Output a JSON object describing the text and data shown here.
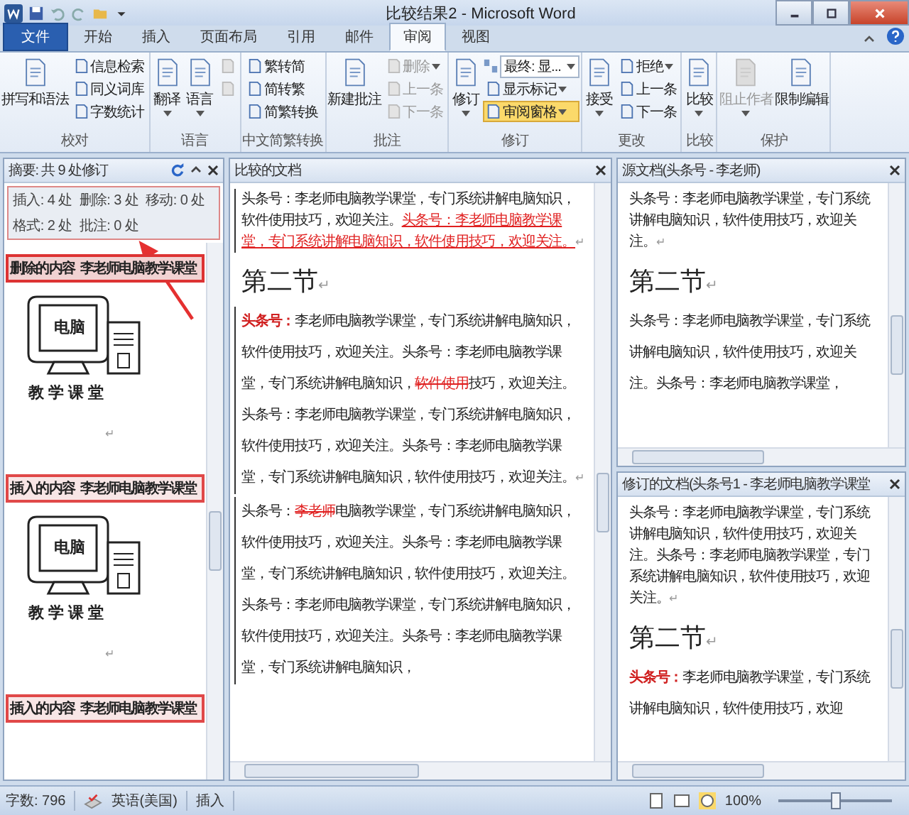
{
  "title_bar": {
    "title": "比较结果2 - Microsoft Word"
  },
  "tabs": [
    {
      "label": "文件",
      "kind": "file",
      "selected": false
    },
    {
      "label": "开始",
      "kind": "tab",
      "selected": false
    },
    {
      "label": "插入",
      "kind": "tab",
      "selected": false
    },
    {
      "label": "页面布局",
      "kind": "tab",
      "selected": false
    },
    {
      "label": "引用",
      "kind": "tab",
      "selected": false
    },
    {
      "label": "邮件",
      "kind": "tab",
      "selected": false
    },
    {
      "label": "审阅",
      "kind": "tab",
      "selected": true
    },
    {
      "label": "视图",
      "kind": "tab",
      "selected": false
    }
  ],
  "ribbon_groups": [
    {
      "label": "校对",
      "buttons": [
        {
          "label": "拼写和语法",
          "kind": "large",
          "disabled": false,
          "dropdown": false
        },
        {
          "label": "信息检索",
          "kind": "small",
          "disabled": false,
          "dropdown": false
        },
        {
          "label": "同义词库",
          "kind": "small",
          "disabled": false,
          "dropdown": false
        },
        {
          "label": "字数统计",
          "kind": "small",
          "disabled": false,
          "dropdown": false
        }
      ]
    },
    {
      "label": "语言",
      "buttons": [
        {
          "label": "翻译",
          "kind": "large",
          "disabled": false,
          "dropdown": true
        },
        {
          "label": "语言",
          "kind": "large",
          "disabled": false,
          "dropdown": true
        },
        {
          "kind": "small",
          "disabled": true,
          "dropdown": false
        },
        {
          "kind": "small",
          "disabled": true,
          "dropdown": false
        }
      ]
    },
    {
      "label": "中文简繁转换",
      "buttons": [
        {
          "label": "繁转简",
          "kind": "small",
          "disabled": false,
          "dropdown": false
        },
        {
          "label": "简转繁",
          "kind": "small",
          "disabled": false,
          "dropdown": false
        },
        {
          "label": "简繁转换",
          "kind": "small",
          "disabled": false,
          "dropdown": false
        }
      ]
    },
    {
      "label": "批注",
      "buttons": [
        {
          "label": "新建批注",
          "kind": "large",
          "disabled": false,
          "dropdown": false
        },
        {
          "label": "删除",
          "kind": "small",
          "disabled": true,
          "dropdown": true
        },
        {
          "label": "上一条",
          "kind": "small",
          "disabled": true,
          "dropdown": false
        },
        {
          "label": "下一条",
          "kind": "small",
          "disabled": true,
          "dropdown": false
        }
      ]
    },
    {
      "label": "修订",
      "buttons": [
        {
          "label": "修订",
          "kind": "large",
          "disabled": false,
          "dropdown": true
        },
        {
          "label": "最终: 显...",
          "kind": "combo",
          "disabled": false,
          "dropdown": true
        },
        {
          "label": "显示标记",
          "kind": "small",
          "disabled": false,
          "dropdown": true
        },
        {
          "label": "审阅窗格",
          "kind": "small",
          "disabled": false,
          "dropdown": true,
          "on": true
        }
      ]
    },
    {
      "label": "更改",
      "buttons": [
        {
          "label": "接受",
          "kind": "large",
          "disabled": false,
          "dropdown": true
        },
        {
          "label": "拒绝",
          "kind": "small",
          "disabled": false,
          "dropdown": true
        },
        {
          "label": "上一条",
          "kind": "small",
          "disabled": false,
          "dropdown": false
        },
        {
          "label": "下一条",
          "kind": "small",
          "disabled": false,
          "dropdown": false
        }
      ]
    },
    {
      "label": "比较",
      "buttons": [
        {
          "label": "比较",
          "kind": "large",
          "disabled": false,
          "dropdown": true
        }
      ]
    },
    {
      "label": "保护",
      "buttons": [
        {
          "label": "阻止作者",
          "kind": "large",
          "disabled": true,
          "dropdown": true
        },
        {
          "label": "限制编辑",
          "kind": "large",
          "disabled": false,
          "dropdown": false
        }
      ]
    }
  ],
  "review_pane": {
    "title": "摘要: 共 9 处修订",
    "summary": [
      "插入: 4 处  删除: 3 处  移动: 0 处",
      "格式: 2 处  批注: 0 处"
    ],
    "entries": [
      {
        "kind": "deleted",
        "label": "删除的内容",
        "author": "李老师电脑教学课堂",
        "image": {
          "screen_text": "电脑",
          "caption": "教 学 课 堂"
        },
        "mark": "↵"
      },
      {
        "kind": "inserted",
        "label": "插入的内容",
        "author": "李老师电脑教学课堂",
        "image": {
          "screen_text": "电脑",
          "caption": "教 学 课 堂"
        },
        "mark": "↵"
      },
      {
        "kind": "inserted",
        "label": "插入的内容",
        "author": "李老师电脑教学课堂"
      }
    ]
  },
  "compared_document": {
    "title": "比较的文档",
    "blocks": [
      {
        "kind": "paragraph",
        "double_spaced": false,
        "change_bar": true,
        "runs": [
          {
            "kind": "plain",
            "text": "头条号：李老师电脑教学课堂，专门系统讲解电脑知识，软件使用技巧，欢迎关注。"
          },
          {
            "kind": "inserted",
            "text": "头条号：李老师电脑教学课堂，专门系统讲解电脑知识，软件使用技巧，欢迎关注。"
          },
          {
            "kind": "mark",
            "text": "↵"
          }
        ]
      },
      {
        "kind": "heading",
        "runs": [
          {
            "kind": "plain",
            "text": "第二节"
          },
          {
            "kind": "mark",
            "text": "↵"
          }
        ]
      },
      {
        "kind": "paragraph",
        "double_spaced": true,
        "change_bar": true,
        "runs": [
          {
            "kind": "format",
            "text": "头条号："
          },
          {
            "kind": "plain",
            "text": "李老师电脑教学课堂，专门系统讲解电脑知识，软件使用技巧，欢迎关注。头条号：李老师电脑教学课堂，专门系统讲解电脑知识，"
          },
          {
            "kind": "deleted",
            "text": "软件使用"
          },
          {
            "kind": "plain",
            "text": "技巧，欢迎关注。头条号：李老师电脑教学课堂，专门系统讲解电脑知识，软件使用技巧，欢迎关注。头条号：李老师电脑教学课堂，专门系统讲解电脑知识，软件使用技巧，欢迎关注。"
          },
          {
            "kind": "mark",
            "text": "↵"
          }
        ]
      },
      {
        "kind": "paragraph",
        "double_spaced": true,
        "change_bar": true,
        "runs": [
          {
            "kind": "plain",
            "text": "头条号："
          },
          {
            "kind": "deleted",
            "text": "李老师"
          },
          {
            "kind": "plain",
            "text": "电脑教学课堂，专门系统讲解电脑知识，软件使用技巧，欢迎关注。头条号：李老师电脑教学课堂，专门系统讲解电脑知识，软件使用技巧，欢迎关注。头条号：李老师电脑教学课堂，专门系统讲解电脑知识，软件使用技巧，欢迎关注。头条号：李老师电脑教学课堂，专门系统讲解电脑知识，"
          }
        ]
      }
    ]
  },
  "original_document": {
    "title": "源文档(头条号 - 李老师)",
    "blocks": [
      {
        "kind": "paragraph",
        "double_spaced": false,
        "change_bar": false,
        "runs": [
          {
            "kind": "plain",
            "text": "头条号：李老师电脑教学课堂，专门系统讲解电脑知识，软件使用技巧，欢迎关注。"
          },
          {
            "kind": "mark",
            "text": "↵"
          }
        ]
      },
      {
        "kind": "heading",
        "runs": [
          {
            "kind": "plain",
            "text": "第二节"
          },
          {
            "kind": "mark",
            "text": "↵"
          }
        ]
      },
      {
        "kind": "paragraph",
        "double_spaced": true,
        "change_bar": false,
        "runs": [
          {
            "kind": "plain",
            "text": "头条号：李老师电脑教学课堂，专门系统讲解电脑知识，软件使用技巧，欢迎关注。头条号：李老师电脑教学课堂，"
          }
        ]
      }
    ]
  },
  "revised_document": {
    "title": "修订的文档(头条号1 - 李老师电脑教学课堂",
    "blocks": [
      {
        "kind": "paragraph",
        "double_spaced": false,
        "change_bar": false,
        "runs": [
          {
            "kind": "plain",
            "text": "头条号：李老师电脑教学课堂，专门系统讲解电脑知识，软件使用技巧，欢迎关注。头条号：李老师电脑教学课堂，专门系统讲解电脑知识，软件使用技巧，欢迎关注。"
          },
          {
            "kind": "mark",
            "text": "↵"
          }
        ]
      },
      {
        "kind": "heading",
        "runs": [
          {
            "kind": "plain",
            "text": "第二节"
          },
          {
            "kind": "mark",
            "text": "↵"
          }
        ]
      },
      {
        "kind": "paragraph",
        "double_spaced": true,
        "change_bar": false,
        "runs": [
          {
            "kind": "format",
            "text": "头条号："
          },
          {
            "kind": "plain",
            "text": "李老师电脑教学课堂，专门系统讲解电脑知识，软件使用技巧，欢迎"
          }
        ]
      }
    ]
  },
  "status_bar": {
    "word_count": "字数: 796",
    "language": "英语(美国)",
    "mode": "插入",
    "zoom": "100%",
    "zoom_slider": {
      "level": 0.5
    }
  }
}
